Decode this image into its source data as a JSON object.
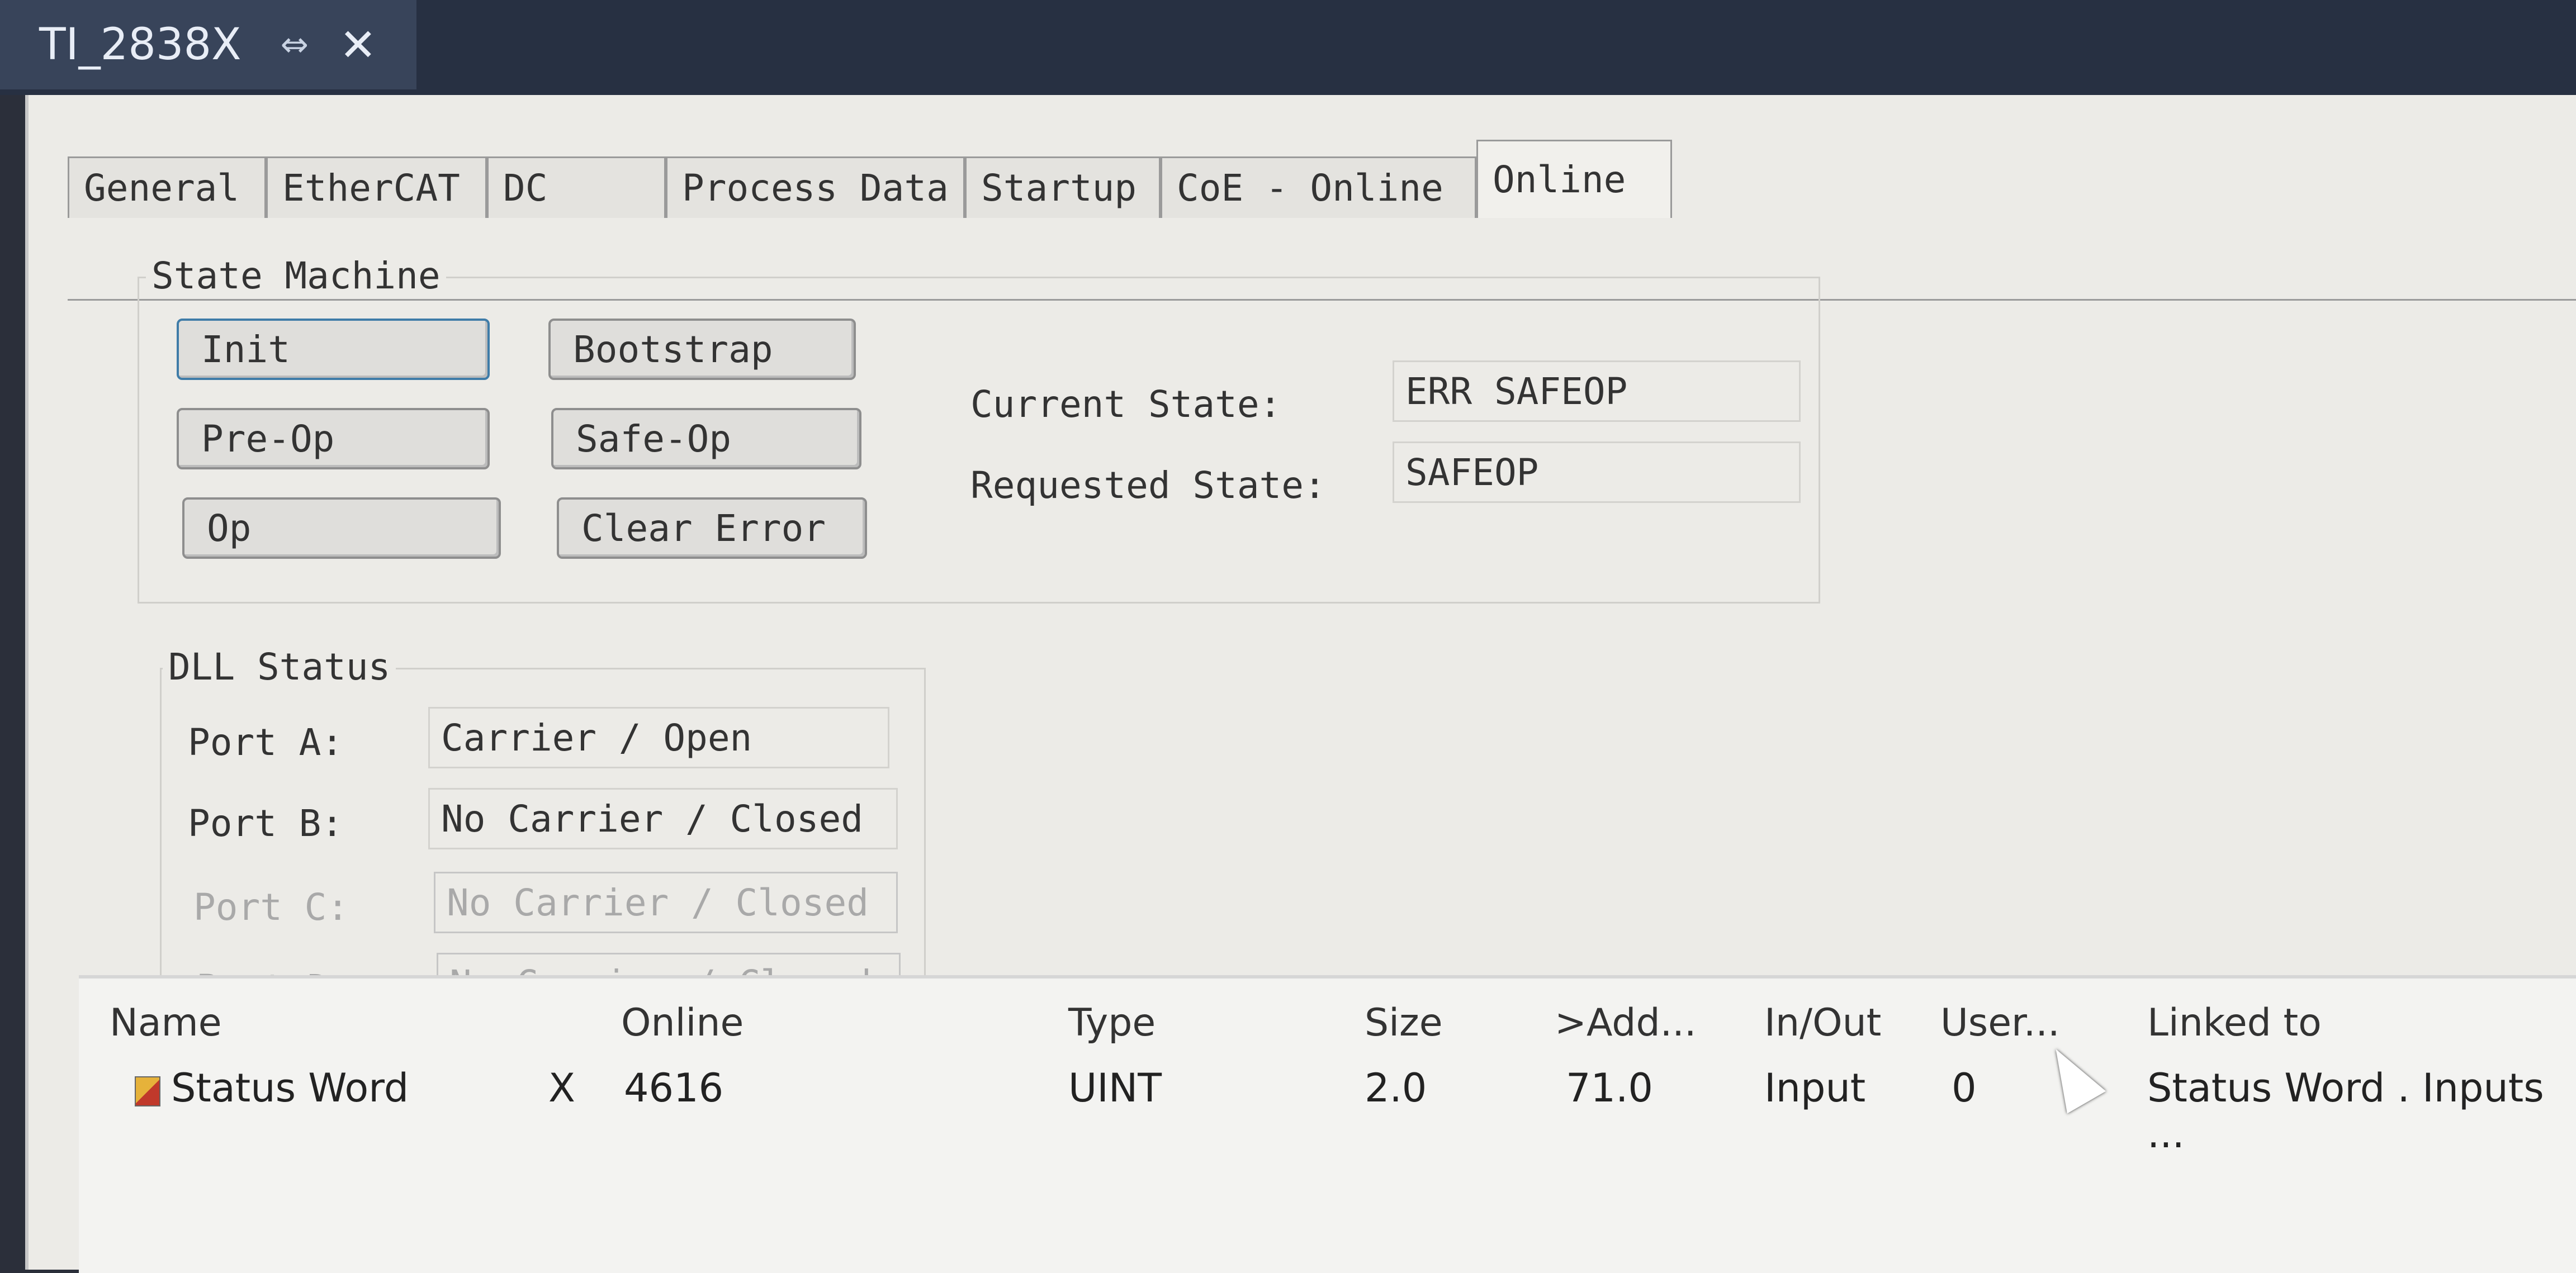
{
  "doc_tab": {
    "title": "TI_2838X",
    "pin": "⇔",
    "close": "✕"
  },
  "tabs": [
    "General",
    "EtherCAT",
    "DC",
    "Process Data",
    "Startup",
    "CoE - Online",
    "Online"
  ],
  "active_tab": "Online",
  "state_machine": {
    "title": "State Machine",
    "buttons": {
      "init": "Init",
      "bootstrap": "Bootstrap",
      "preop": "Pre-Op",
      "safeop": "Safe-Op",
      "op": "Op",
      "clear_error": "Clear Error"
    },
    "current_state_label": "Current State:",
    "current_state_value": "ERR SAFEOP",
    "requested_state_label": "Requested State:",
    "requested_state_value": "SAFEOP"
  },
  "dll_status": {
    "title": "DLL Status",
    "ports": [
      {
        "label": "Port A:",
        "value": "Carrier / Open",
        "enabled": true
      },
      {
        "label": "Port B:",
        "value": "No Carrier / Closed",
        "enabled": true
      },
      {
        "label": "Port C:",
        "value": "No Carrier / Closed",
        "enabled": false
      },
      {
        "label": "Port D:",
        "value": "No Carrier / Closed",
        "enabled": false
      }
    ]
  },
  "variables": {
    "columns": [
      "Name",
      "Online",
      "Type",
      "Size",
      ">Add...",
      "In/Out",
      "User...",
      "Linked to"
    ],
    "rows": [
      {
        "name": "Status Word",
        "flag": "X",
        "online": "4616",
        "type": "UINT",
        "size": "2.0",
        "address": "71.0",
        "inout": "Input",
        "user": "0",
        "linked": "Status Word . Inputs ..."
      }
    ]
  }
}
